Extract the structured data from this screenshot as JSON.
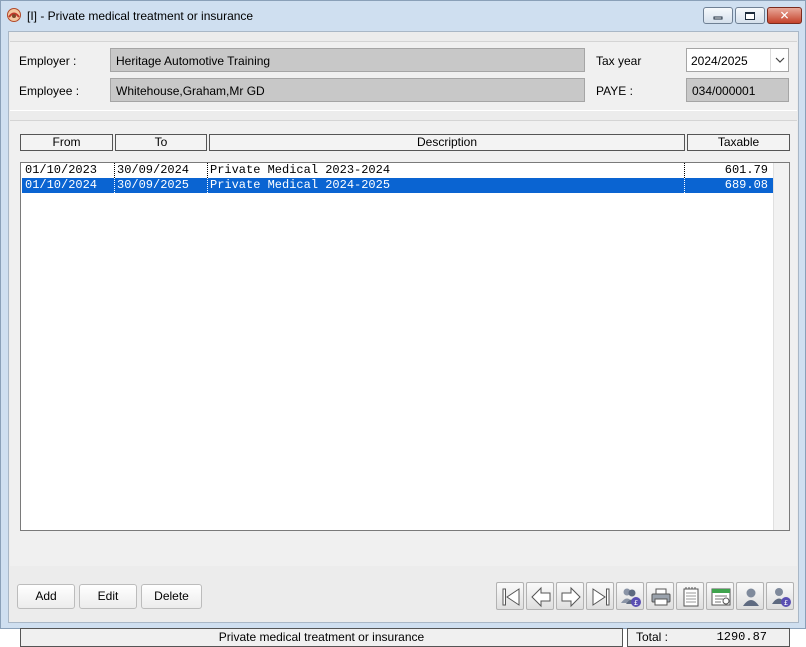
{
  "window": {
    "title": "[I] - Private medical treatment or insurance",
    "app_icon": "app-logo-icon",
    "controls": {
      "minimize": "minimize-icon",
      "maximize": "maximize-icon",
      "close": "close-icon"
    }
  },
  "header": {
    "employer_label": "Employer :",
    "employer_value": "Heritage Automotive Training",
    "employee_label": "Employee :",
    "employee_value": "Whitehouse,Graham,Mr GD",
    "tax_year_label": "Tax year",
    "tax_year_value": "2024/2025",
    "paye_label": "PAYE :",
    "paye_value": "034/000001"
  },
  "table": {
    "columns": {
      "from": "From",
      "to": "To",
      "description": "Description",
      "taxable": "Taxable"
    },
    "rows": [
      {
        "from": "01/10/2023",
        "to": "30/09/2024",
        "description": "Private Medical 2023-2024",
        "taxable": "601.79",
        "selected": false
      },
      {
        "from": "01/10/2024",
        "to": "30/09/2025",
        "description": "Private Medical 2024-2025",
        "taxable": "689.08",
        "selected": true
      }
    ],
    "selection_color": "#0a64d2"
  },
  "footer": {
    "caption": "Private medical treatment or insurance",
    "total_label": "Total :",
    "total_value": "1290.87"
  },
  "buttons": {
    "add": "Add",
    "edit": "Edit",
    "delete": "Delete"
  },
  "toolbar": [
    "first-record-icon",
    "previous-record-icon",
    "next-record-icon",
    "last-record-icon",
    "employees-pay-icon",
    "print-icon",
    "notepad-icon",
    "calendar-report-icon",
    "employee-icon",
    "employee-pay-icon"
  ]
}
